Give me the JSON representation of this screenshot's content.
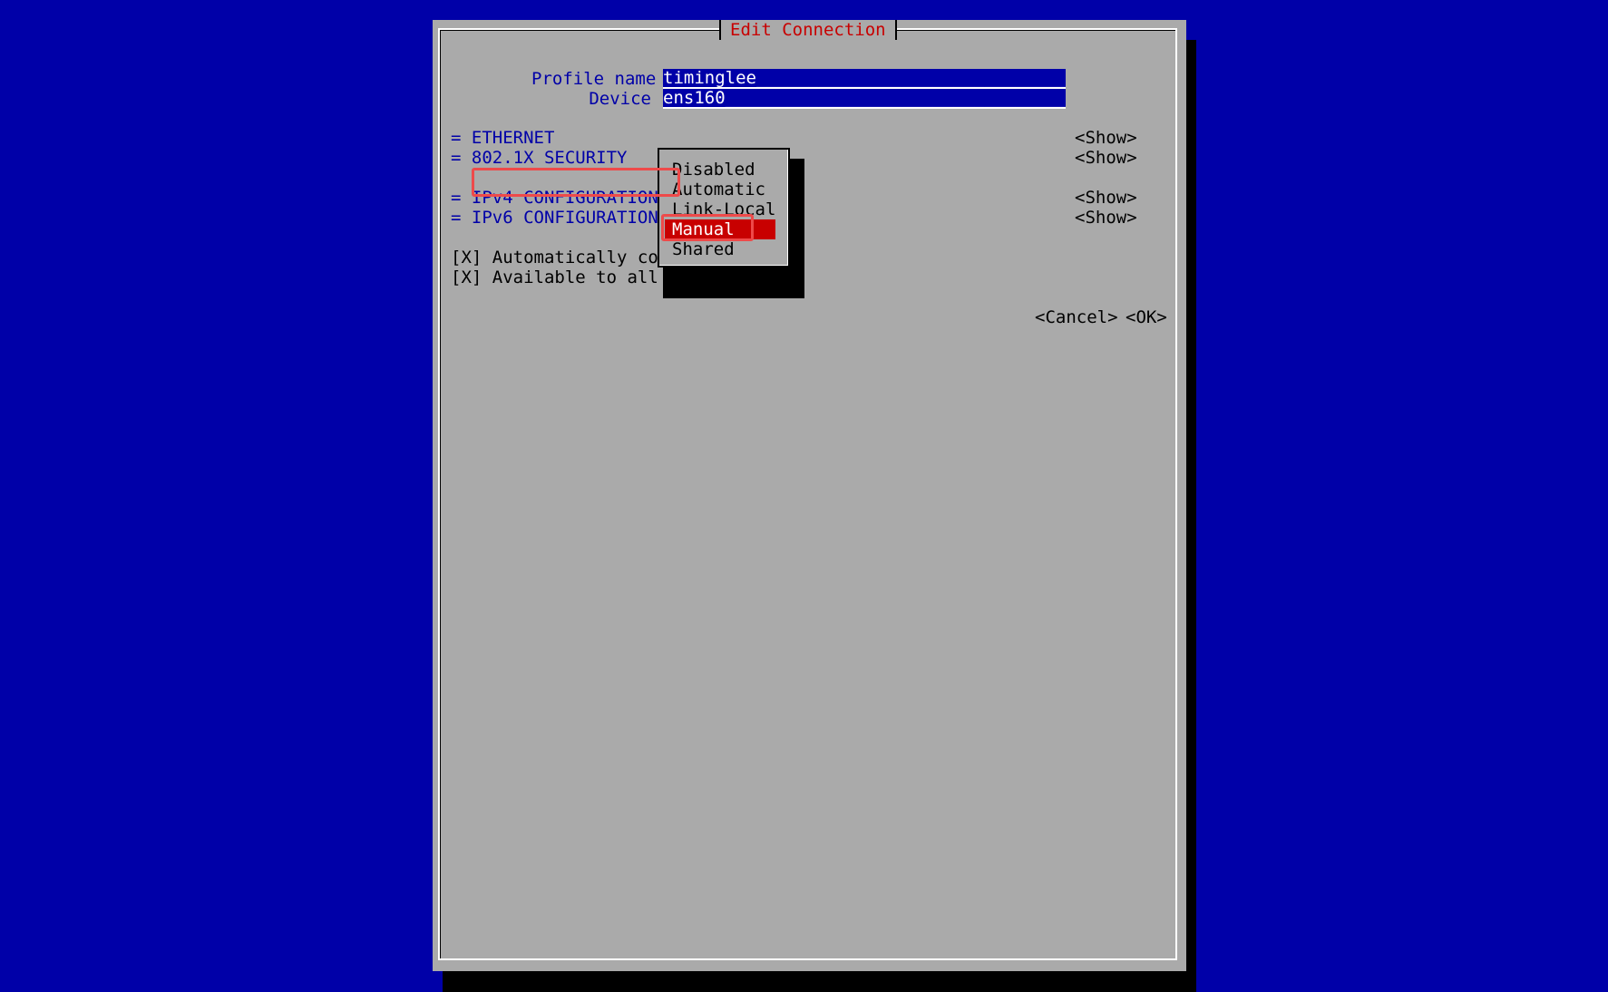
{
  "dialog": {
    "title": "Edit Connection"
  },
  "form": {
    "profile_name_label": "Profile name",
    "profile_name_value": "timinglee",
    "profile_name_fill": "_______________________________",
    "device_label": "Device",
    "device_value": "ens160",
    "device_fill": "______________________________________"
  },
  "sections": [
    {
      "label": "= ETHERNET",
      "action": "<Show>"
    },
    {
      "label": "= 802.1X SECURITY",
      "action": "<Show>"
    },
    {
      "label": "= IPv4 CONFIGURATION",
      "action": "<Show>"
    },
    {
      "label": "= IPv6 CONFIGURATION",
      "action": "<Show>"
    }
  ],
  "options": {
    "auto_connect": "[X] Automatically co",
    "available_all": "[X] Available to all"
  },
  "buttons": {
    "cancel": "<Cancel>",
    "ok": "<OK>"
  },
  "dropdown": {
    "items": [
      "Disabled",
      "Automatic",
      "Link-Local",
      "Manual",
      "Shared"
    ],
    "selected": "Manual"
  },
  "colors": {
    "background": "#0000a8",
    "dialog": "#aaaaaa",
    "accent_red": "#c80000",
    "annotation": "#ee4a4a"
  }
}
